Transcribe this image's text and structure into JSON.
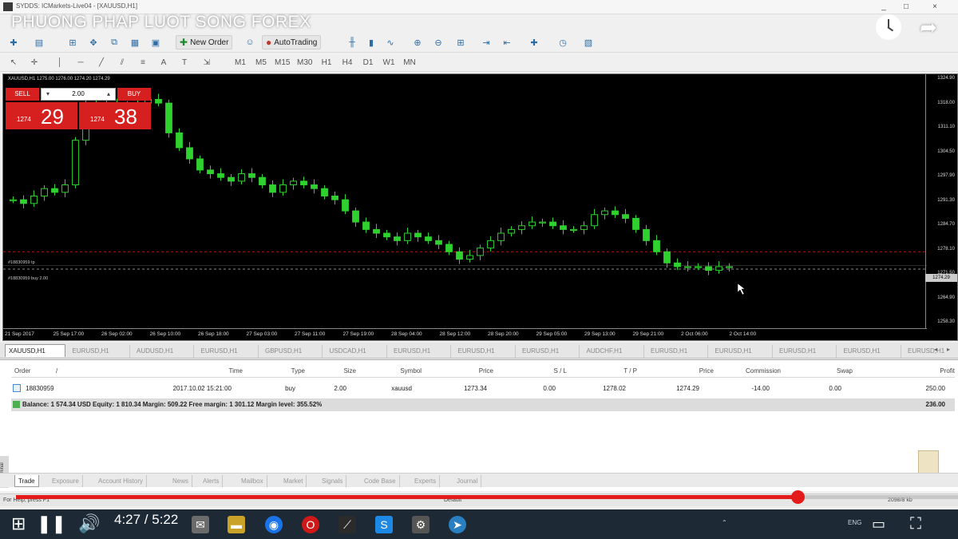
{
  "window": {
    "title": "SYDDS: ICMarkets-Live04 - [XAUUSD,H1]",
    "controls": [
      "_",
      "□",
      "×"
    ]
  },
  "video": {
    "title": "PHUONG PHAP LUOT SONG FOREX",
    "time": "4:27 / 5:22",
    "progress_fraction": 0.83,
    "icons": {
      "clock": "clock-icon",
      "share": "share-arrow-icon"
    }
  },
  "toolbar": {
    "new_order": "New Order",
    "auto_trading": "AutoTrading",
    "timeframes": [
      "M1",
      "M5",
      "M15",
      "M30",
      "H1",
      "H4",
      "D1",
      "W1",
      "MN"
    ]
  },
  "chart": {
    "header": "XAUUSD,H1  1275.00 1276.00 1274.20 1274.29",
    "trade_panel": {
      "sell_label": "SELL",
      "buy_label": "BUY",
      "lot": "2.00",
      "sell_prefix": "1274",
      "sell_big": "29",
      "buy_prefix": "1274",
      "buy_big": "38"
    },
    "levels": {
      "tp_label": "#18830959 tp",
      "entry_label": "#18830959 buy 2.00"
    },
    "current_price_tag": "1274.29",
    "price_ticks": [
      "1324.90",
      "1318.00",
      "1311.10",
      "1304.50",
      "1297.90",
      "1291.30",
      "1284.70",
      "1278.10",
      "1271.50",
      "1264.90",
      "1258.30"
    ],
    "time_labels": [
      "21 Sep 2017",
      "25 Sep 17:00",
      "26 Sep 02:00",
      "26 Sep 10:00",
      "26 Sep 18:00",
      "27 Sep 03:00",
      "27 Sep 11:00",
      "27 Sep 19:00",
      "28 Sep 04:00",
      "28 Sep 12:00",
      "28 Sep 20:00",
      "29 Sep 05:00",
      "29 Sep 13:00",
      "29 Sep 21:00",
      "2 Oct 06:00",
      "2 Oct 14:00"
    ]
  },
  "chart_data": {
    "type": "candlestick",
    "symbol": "XAUUSD",
    "timeframe": "H1",
    "closes": [
      1292,
      1291,
      1293,
      1295,
      1294,
      1296,
      1308,
      1318,
      1317,
      1318,
      1316,
      1317,
      1318,
      1319,
      1318,
      1310,
      1306,
      1303,
      1300,
      1299,
      1298,
      1297,
      1299,
      1298,
      1296,
      1294,
      1296,
      1297,
      1296,
      1295,
      1293,
      1292,
      1289,
      1286,
      1284,
      1283,
      1282,
      1281,
      1283,
      1282,
      1281,
      1280,
      1278,
      1276,
      1277,
      1279,
      1281,
      1283,
      1284,
      1285,
      1286,
      1286,
      1285,
      1284,
      1284,
      1285,
      1288,
      1289,
      1288,
      1287,
      1284,
      1281,
      1278,
      1275,
      1274,
      1274,
      1274,
      1273,
      1274,
      1274
    ],
    "current_price": 1274.29,
    "order_entry": 1273.34,
    "take_profit": 1278.02
  },
  "symbol_tabs": [
    "XAUUSD,H1",
    "EURUSD,H1",
    "AUDUSD,H1",
    "EURUSD,H1",
    "GBPUSD,H1",
    "USDCAD,H1",
    "EURUSD,H1",
    "EURUSD,H1",
    "EURUSD,H1",
    "AUDCHF,H1",
    "EURUSD,H1",
    "EURUSD,H1",
    "EURUSD,H1",
    "EURUSD,H1",
    "EURUSD,H1"
  ],
  "terminal": {
    "columns": [
      "Order",
      "/",
      "Time",
      "Type",
      "Size",
      "Symbol",
      "Price",
      "S / L",
      "T / P",
      "Price",
      "Commission",
      "Swap",
      "Profit"
    ],
    "row": {
      "order": "18830959",
      "time": "2017.10.02 15:21:00",
      "type": "buy",
      "size": "2.00",
      "symbol": "xauusd",
      "price": "1273.34",
      "sl": "0.00",
      "tp": "1278.02",
      "current_price": "1274.29",
      "commission": "-14.00",
      "swap": "0.00",
      "profit": "250.00"
    },
    "balance_text": "Balance: 1 574.34 USD  Equity: 1 810.34  Margin: 509.22  Free margin: 1 301.12  Margin level: 355.52%",
    "balance_profit": "236.00",
    "side_label": "Terminal"
  },
  "bottom_tabs": [
    "Trade",
    "Exposure",
    "Account History",
    "News",
    "Alerts",
    "Mailbox",
    "Market",
    "Signals",
    "Code Base",
    "Experts",
    "Journal"
  ],
  "status": {
    "left": "For Help, press F1",
    "middle": "Default",
    "right": "2098/8 kb"
  },
  "taskbar": {
    "tray_lang": "ENG"
  },
  "colors": {
    "candle": "#2fd12f",
    "trade_red": "#d62020",
    "progress": "#e41b1b",
    "taskbar": "#1d2a36"
  }
}
